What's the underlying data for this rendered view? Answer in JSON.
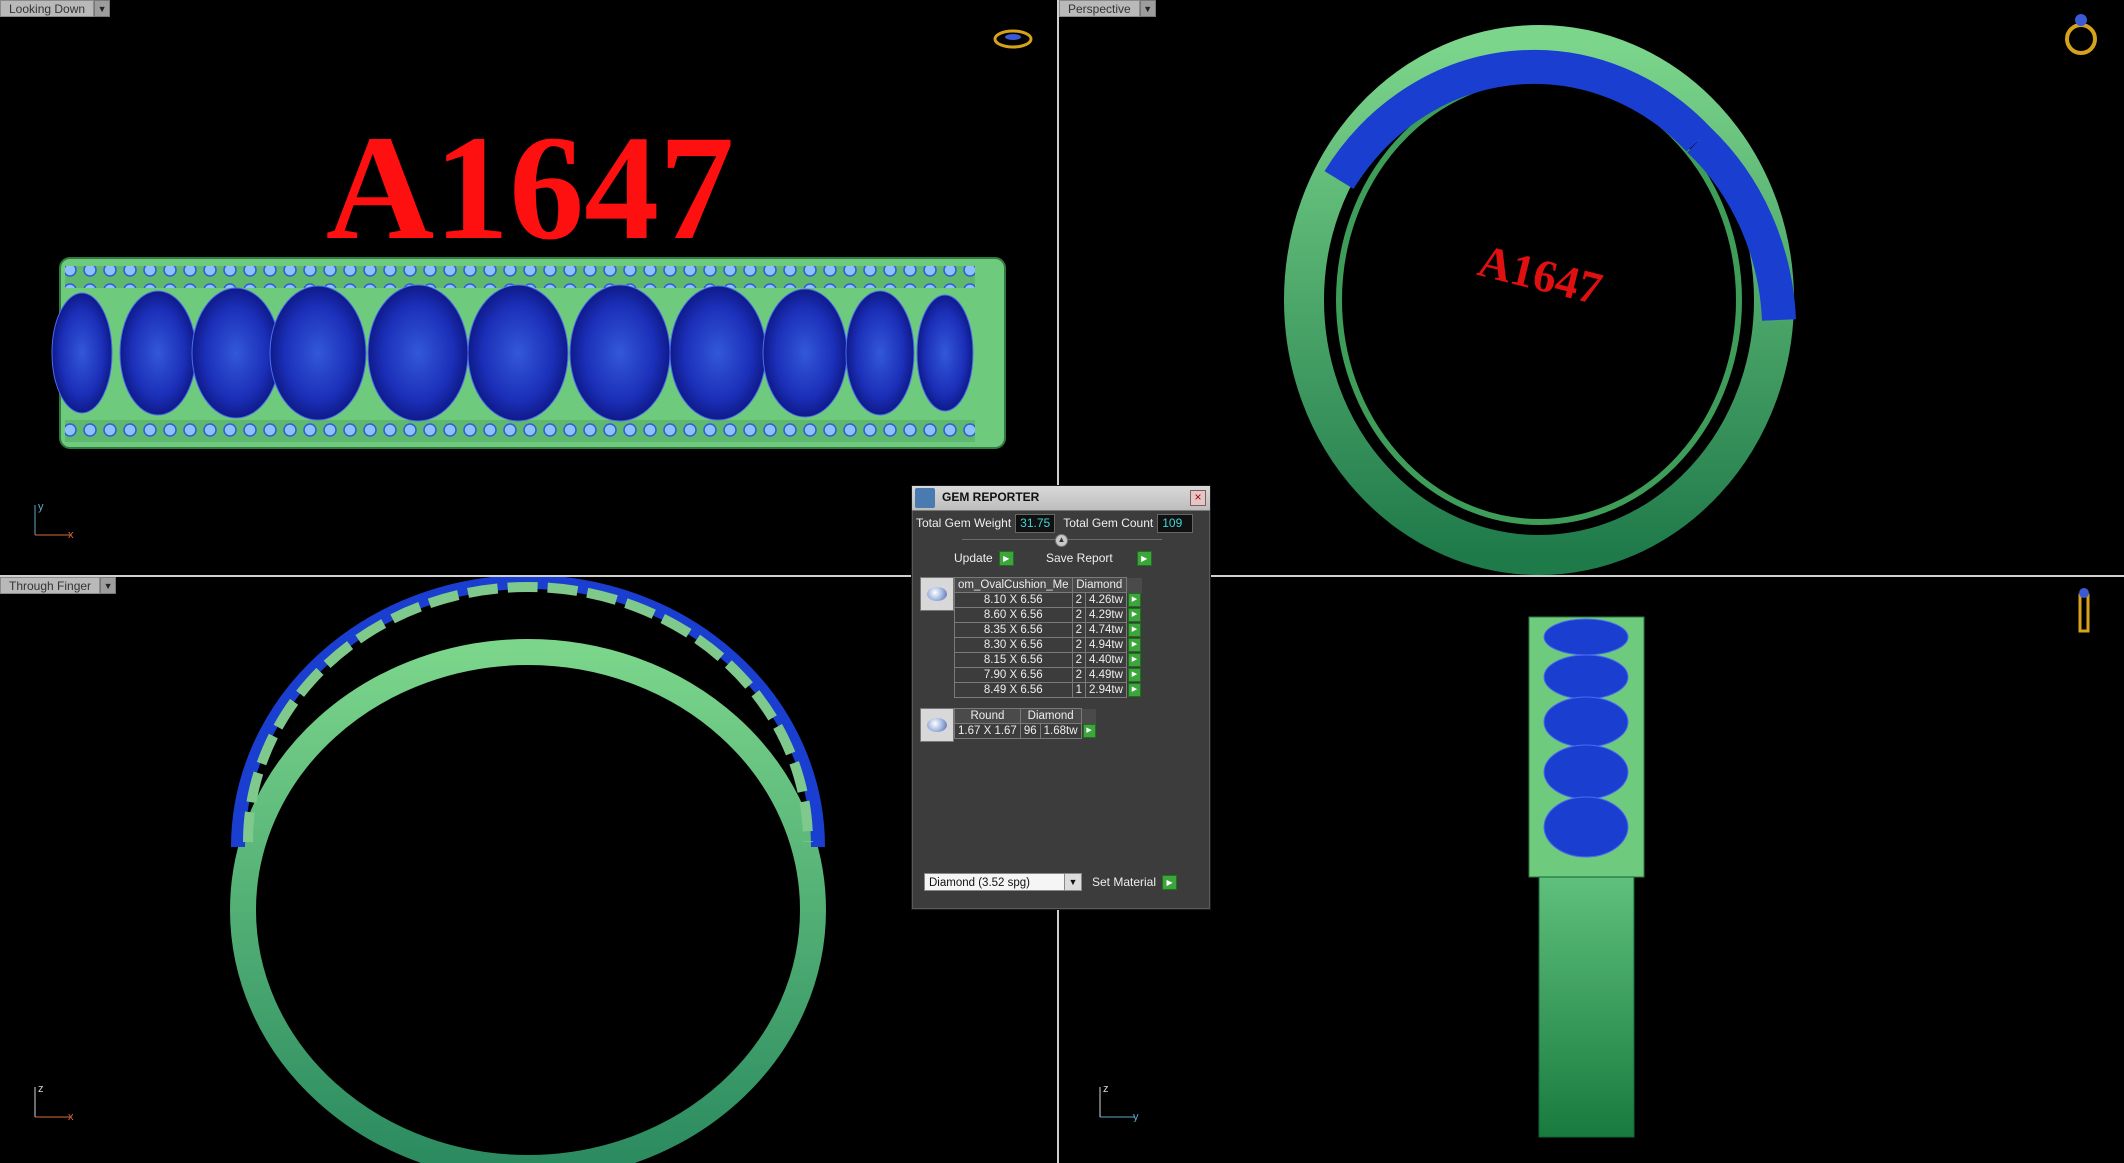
{
  "viewports": {
    "top_left": {
      "label": "Looking Down",
      "axis": {
        "v": "y",
        "h": "x"
      }
    },
    "top_right": {
      "label": "Perspective"
    },
    "bottom_left": {
      "label": "Through Finger",
      "axis": {
        "v": "z",
        "h": "x"
      }
    },
    "bottom_right": {
      "axis": {
        "v": "z",
        "h": "y"
      }
    }
  },
  "engraving": {
    "text": "A1647"
  },
  "gem_reporter": {
    "title": "GEM REPORTER",
    "total_weight_label": "Total Gem Weight",
    "total_weight_value": "31.75",
    "total_count_label": "Total Gem Count",
    "total_count_value": "109",
    "update_label": "Update",
    "save_report_label": "Save Report",
    "groups": [
      {
        "shape": "om_OvalCushion_Me",
        "material": "Diamond",
        "rows": [
          {
            "size": "8.10 X 6.56",
            "count": "2",
            "weight": "4.26tw"
          },
          {
            "size": "8.60 X 6.56",
            "count": "2",
            "weight": "4.29tw"
          },
          {
            "size": "8.35 X 6.56",
            "count": "2",
            "weight": "4.74tw"
          },
          {
            "size": "8.30 X 6.56",
            "count": "2",
            "weight": "4.94tw"
          },
          {
            "size": "8.15 X 6.56",
            "count": "2",
            "weight": "4.40tw"
          },
          {
            "size": "7.90 X 6.56",
            "count": "2",
            "weight": "4.49tw"
          },
          {
            "size": "8.49 X 6.56",
            "count": "1",
            "weight": "2.94tw"
          }
        ]
      },
      {
        "shape": "Round",
        "material": "Diamond",
        "rows": [
          {
            "size": "1.67 X 1.67",
            "count": "96",
            "weight": "1.68tw"
          }
        ]
      }
    ],
    "material_select": "Diamond    (3.52 spg)",
    "set_material_label": "Set Material"
  },
  "colors": {
    "metal_green": "#4fbf6a",
    "gem_blue": "#1a3fd0",
    "accent_blue": "#7ab4ff",
    "engraving_red": "#ff1010"
  }
}
